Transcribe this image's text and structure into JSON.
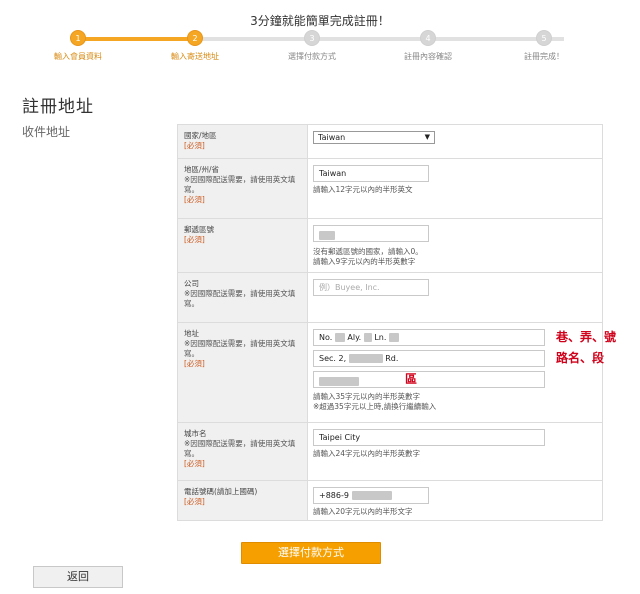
{
  "header": {
    "title": "3分鐘就能簡單完成註冊！"
  },
  "steps": [
    {
      "num": "1",
      "label": "輸入會員資料"
    },
    {
      "num": "2",
      "label": "輸入寄送地址"
    },
    {
      "num": "3",
      "label": "選擇付款方式"
    },
    {
      "num": "4",
      "label": "註冊內容確認"
    },
    {
      "num": "5",
      "label": "註冊完成！"
    }
  ],
  "page_title": "註冊地址",
  "section_label": "收件地址",
  "form": {
    "country": {
      "label": "國家/地區",
      "required": "[必須]",
      "value": "Taiwan"
    },
    "state": {
      "label": "地區/州/省",
      "note": "※因國際配送需要，請使用英文填寫。",
      "required": "[必須]",
      "value": "Taiwan",
      "hint": "請輸入12字元以內的半形英文"
    },
    "postal": {
      "label": "郵遞區號",
      "required": "[必須]",
      "hint1": "沒有郵遞區號的國家，請輸入0。",
      "hint2": "請輸入9字元以內的半形英數字"
    },
    "company": {
      "label": "公司",
      "note": "※因國際配送需要，請使用英文填寫。",
      "placeholder": "例）Buyee, Inc."
    },
    "address": {
      "label": "地址",
      "note": "※因國際配送需要，請使用英文填寫。",
      "required": "[必須]",
      "line1_a": "No.",
      "line1_b": "Aly.",
      "line1_c": "Ln.",
      "line2_a": "Sec. 2,",
      "line2_b": "Rd.",
      "annot1": "巷、弄、號",
      "annot2": "路名、段",
      "annot3": "區",
      "hint1": "請輸入35字元以內的半形英數字",
      "hint2": "※超過35字元以上時,請換行繼續輸入"
    },
    "city": {
      "label": "城市名",
      "note": "※因國際配送需要，請使用英文填寫。",
      "required": "[必須]",
      "value": "Taipei City",
      "hint": "請輸入24字元以內的半形英數字"
    },
    "phone": {
      "label": "電話號碼(請加上國碼)",
      "required": "[必須]",
      "value": "+886-9",
      "hint": "請輸入20字元以內的半形文字"
    }
  },
  "buttons": {
    "next": "選擇付款方式",
    "back": "返回"
  },
  "colors": {
    "accent": "#f5a623",
    "button": "#f5a000",
    "required": "#cc5a1f",
    "annotation": "#d0021b"
  }
}
